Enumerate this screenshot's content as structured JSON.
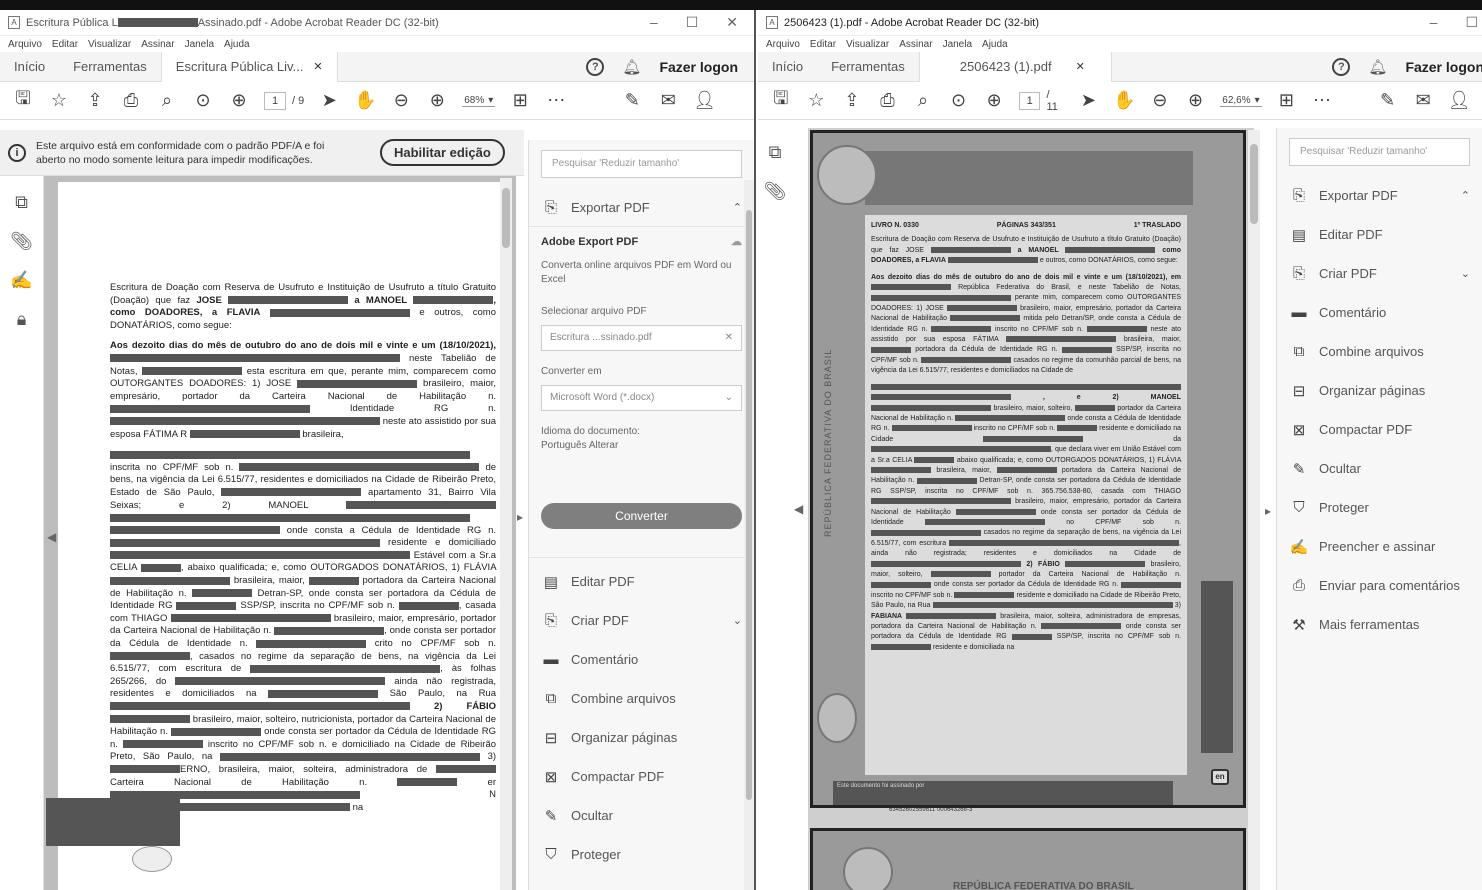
{
  "left": {
    "title_prefix": "Escritura Pública L",
    "title_suffix": "Assinado.pdf - Adobe Acrobat Reader DC (32-bit)",
    "menu": [
      "Arquivo",
      "Editar",
      "Visualizar",
      "Assinar",
      "Janela",
      "Ajuda"
    ],
    "tabs": {
      "home": "Início",
      "tools": "Ferramentas",
      "doc": "Escritura Pública Liv..."
    },
    "logon": "Fazer logon",
    "page_current": "1",
    "page_total": "/ 9",
    "zoom": "68%",
    "info_text": "Este arquivo está em conformidade com o padrão PDF/A e foi aberto no modo somente leitura para impedir modificações.",
    "enable_button": "Habilitar edição",
    "search_placeholder": "Pesquisar 'Reduzir tamanho'",
    "export_header": "Exportar PDF",
    "export": {
      "title": "Adobe Export PDF",
      "desc": "Converta online arquivos PDF em Word ou Excel",
      "select_label": "Selecionar arquivo PDF",
      "file_name": "Escritura ...ssinado.pdf",
      "convert_label": "Converter em",
      "convert_value": "Microsoft Word (*.docx)",
      "lang_label": "Idioma do documento:",
      "lang_value": "Português",
      "lang_change": "Alterar",
      "convert_button": "Converter"
    },
    "tools": [
      "Editar PDF",
      "Criar PDF",
      "Comentário",
      "Combine arquivos",
      "Organizar páginas",
      "Compactar PDF",
      "Ocultar",
      "Proteger"
    ],
    "doc_text": {
      "p1a": "Escritura de Doação com Reserva de Usufruto e Instituição de Usufruto a título Gratuito (Doação) que faz",
      "jose": "JOSE",
      "manoel": "a MANOEL",
      "doadores": ", como DOADORES, a FLAVIA",
      "p1b": "e outros, como DONATÁRIOS, como segue:",
      "p2a": "Aos dezoito dias do mês de outubro do ano de dois mil e vinte e um (18/10/2021),",
      "p2b": "neste Tabelião de Notas,",
      "p2c": "esta escritura em que, perante mim, comparecem como OUTORGANTES DOADORES: 1) JOSE",
      "p2d": "brasileiro, maior, empresário, portador da Carteira Nacional de Habilitação n.",
      "p2e": "Identidade RG n.",
      "p2f": "neste ato assistido por sua esposa FÁTIMA R",
      "p2g": "brasileira,",
      "p3a": "inscrita no CPF/MF sob n.",
      "p3b": "de bens, na vigência da Lei 6.515/77, residentes e domiciliados na Cidade de Ribeirão Preto, Estado de São Paulo,",
      "p3c": "apartamento 31, Bairro Vila Seixas; e 2) MANOEL",
      "p3d": "onde consta a Cédula de Identidade RG n.",
      "p3e": "residente e domiciliado",
      "p3f": "Estável",
      "p3g": "com a Sr.a CELIA",
      "p3h": ", abaixo qualificada; e, como OUTORGADOS DONATÁRIOS, 1) FLÁVIA",
      "p3i": "brasileira, maior,",
      "p3j": "portadora da Carteira Nacional de Habilitação n.",
      "p3k": "Detran-SP, onde consta ser portadora da Cédula de Identidade RG",
      "p3l": "SSP/SP, inscrita no CPF/MF sob n.",
      "p3m": ", casada com THIAGO",
      "p3n": "brasileiro, maior, empresário, portador da Carteira Nacional de Habilitação n.",
      "p3o": ", onde consta ser portador da Cédula de Identidade n.",
      "p3p": "crito no CPF/MF sob n.",
      "p3q": ", casados no regime da separação de bens, na vigência da Lei 6.515/77, com escritura de",
      "p3r": ", às folhas 265/266, do",
      "p3s": "ainda não registrada, residentes e domiciliados na",
      "p3t": "São Paulo, na Rua",
      "p3u": "2) FÁBIO",
      "p3v": "brasileiro, maior, solteiro, nutricionista, portador da Carteira Nacional de Habilitação n.",
      "p3w": "onde consta ser portador da Cédula de Identidade RG n.",
      "p3x": "inscrito no CPF/MF sob n.",
      "p3y": "e domiciliado na Cidade de Ribeirão Preto, São Paulo, na",
      "p3z": "3)",
      "p4a": "ERNO, brasileira, maior, solteira, administradora de",
      "p4b": "Carteira Nacional de Habilitação n.",
      "p4c": "er",
      "p4d": "N",
      "p4e": "na"
    }
  },
  "right": {
    "title": "2506423 (1).pdf - Adobe Acrobat Reader DC (32-bit)",
    "menu": [
      "Arquivo",
      "Editar",
      "Visualizar",
      "Assinar",
      "Janela",
      "Ajuda"
    ],
    "tabs": {
      "home": "Início",
      "tools": "Ferramentas",
      "doc": "2506423 (1).pdf"
    },
    "logon": "Fazer logon",
    "page_current": "1",
    "page_total": "/ 11",
    "zoom": "62,6%",
    "search_placeholder": "Pesquisar 'Reduzir tamanho'",
    "tools": [
      "Exportar PDF",
      "Editar PDF",
      "Criar PDF",
      "Comentário",
      "Combine arquivos",
      "Organizar páginas",
      "Compactar PDF",
      "Ocultar",
      "Proteger",
      "Preencher e assinar",
      "Enviar para comentários",
      "Mais ferramentas"
    ],
    "scan": {
      "livro": "LIVRO N. 0330",
      "paginas": "PÁGINAS 343/351",
      "traslado": "1º TRASLADO",
      "side": "REPÚBLICA FEDERATIVA DO BRASIL",
      "s1": "Escritura de Doação com Reserva de Usufruto e Instituição de Usufruto a título Gratuito (Doação) que faz JOSE",
      "s1b": "a MANOEL",
      "s1c": "como DOADORES, a FLAVIA",
      "s1d": "e outros, como DONATÁRIOS, como segue:",
      "s2": "Aos dezoito dias do mês de outubro do ano de dois mil e vinte e um (18/10/2021), em",
      "s2b": "República Federativa do Brasil, e neste Tabelião de Notas,",
      "s2c": "perante mim, comparecem como OUTORGANTES DOADORES: 1) JOSE",
      "s2d": "brasileiro, maior, empresário, portador da Carteira Nacional de Habilitação",
      "s2e": "mitida pelo Detran/SP, onde consta a Cédula de Identidade RG n.",
      "s2f": "inscrito no CPF/MF sob n.",
      "s2g": "neste ato assistido por sua esposa FÁTIMA",
      "s2h": "brasileira, maior,",
      "s2i": "portadora da Cédula de Identidade RG n.",
      "s2j": "SSP/SP, inscrita no CPF/MF sob n.",
      "s2k": "casados no regime da comunhão parcial de bens, na vigência da Lei 6.515/77, residentes e domiciliados na Cidade de",
      "s3": ", e 2) MANOEL",
      "s3b": "brasileiro, maior, solteiro,",
      "s3c": "portador da Carteira Nacional de Habilitação n.",
      "s3d": "onde consta a Cédula de Identidade RG n.",
      "s3e": "inscrito no CPF/MF sob n.",
      "s3f": "residente e domiciliado na Cidade",
      "s3g": "da",
      "s3h": ", que declara viver em União Estável com a Sr.a CELIA",
      "s3i": "abaixo qualificada; e, como OUTORGADOS DONATÁRIOS, 1) FLÁVIA",
      "s3j": "brasileira, maior,",
      "s3k": "portadora da Carteira Nacional de Habilitação n.",
      "s3l": "Detran-SP, onde consta ser portadora da Cédula de Identidade RG",
      "s3m": "SSP/SP, inscrita no CPF/MF sob n. 365.756.538-80, casada com THIAGO",
      "s3n": "brasileiro, maior, empresário, portador da Carteira Nacional de Habilitação",
      "s3o": "onde consta ser portador da Cédula de Identidade",
      "s3p": "no CPF/MF sob n.",
      "s3q": "casados no regime da separação de bens, na vigência da Lei 6.515/77, com escritura",
      "s3r": ", ainda não registrada; residentes e domiciliados na Cidade de",
      "s3s": "2) FÁBIO",
      "s3t": "brasileiro, maior, solteiro,",
      "s3u": "portador da Carteira Nacional de Habilitação n.",
      "s3v": "onde consta ser portador da Cédula de Identidade RG n.",
      "s3w": "inscrito no CPF/MF sob n.",
      "s3x": "residente e domiciliado na Cidade de Ribeirão Preto, São Paulo, na Rua",
      "s3y": "3)",
      "s4": "FABIANA",
      "s4b": "brasileira, maior, solteira, administradora de empresas, portadora da Carteira Nacional de Habilitação n.",
      "s4c": "onde consta ser portadora da Cédula de Identidade RG",
      "s4d": "SSP/SP, inscrita no CPF/MF sob n.",
      "s4e": "residente e domiciliada na",
      "footer_note": "Este documento foi assinado por",
      "footer_code": "63452602559611 000643268-3",
      "republica": "REPÚBLICA FEDERATIVA DO BRASIL",
      "badge": "en"
    }
  },
  "colors": {
    "redaction": "#555555",
    "panel_bg": "#f7f7f7",
    "doc_bg": "#bdbdbd",
    "convert_btn": "#7f7f7f"
  }
}
